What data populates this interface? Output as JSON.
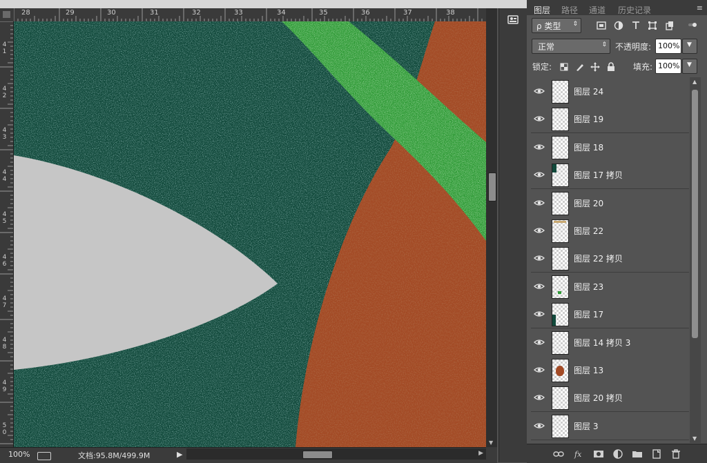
{
  "ruler": {
    "h_labels": [
      "28",
      "29",
      "30",
      "31",
      "32",
      "33",
      "34",
      "35",
      "36",
      "37",
      "38"
    ],
    "v_labels": [
      [
        "4",
        "1"
      ],
      [
        "4",
        "2"
      ],
      [
        "4",
        "3"
      ],
      [
        "4",
        "4"
      ],
      [
        "4",
        "5"
      ],
      [
        "4",
        "6"
      ],
      [
        "4",
        "7"
      ],
      [
        "4",
        "8"
      ],
      [
        "4",
        "9"
      ],
      [
        "5",
        "0"
      ]
    ]
  },
  "status": {
    "zoom": "100%",
    "doc": "文档:95.8M/499.9M"
  },
  "panel": {
    "tabs": [
      "图层",
      "路径",
      "通道",
      "历史记录"
    ],
    "filter_label": "ρ 类型",
    "blend_mode": "正常",
    "opacity_label": "不透明度:",
    "opacity_value": "100%",
    "lock_label": "锁定:",
    "fill_label": "填充:",
    "fill_value": "100%"
  },
  "layers": [
    {
      "name": "图层 24",
      "thumb": "none"
    },
    {
      "name": "图层 19",
      "thumb": "none"
    },
    {
      "name": "图层 18",
      "thumb": "none"
    },
    {
      "name": "图层 17 拷贝",
      "thumb": "teal-corner"
    },
    {
      "name": "图层 20",
      "thumb": "none"
    },
    {
      "name": "图层 22",
      "thumb": "tan-top"
    },
    {
      "name": "图层 22 拷贝",
      "thumb": "none"
    },
    {
      "name": "图层 23",
      "thumb": "green-speck"
    },
    {
      "name": "图层 17",
      "thumb": "teal-bottom"
    },
    {
      "name": "图层 14 拷贝 3",
      "thumb": "none"
    },
    {
      "name": "图层 13",
      "thumb": "orange-blob"
    },
    {
      "name": "图层 20 拷贝",
      "thumb": "none"
    },
    {
      "name": "图层 3",
      "thumb": "none"
    }
  ],
  "colors": {
    "canvas_teal": "#124a3c",
    "shape_gray": "#c6c6c6",
    "band_green": "#2f9a36",
    "shape_orange": "#a34a25"
  }
}
